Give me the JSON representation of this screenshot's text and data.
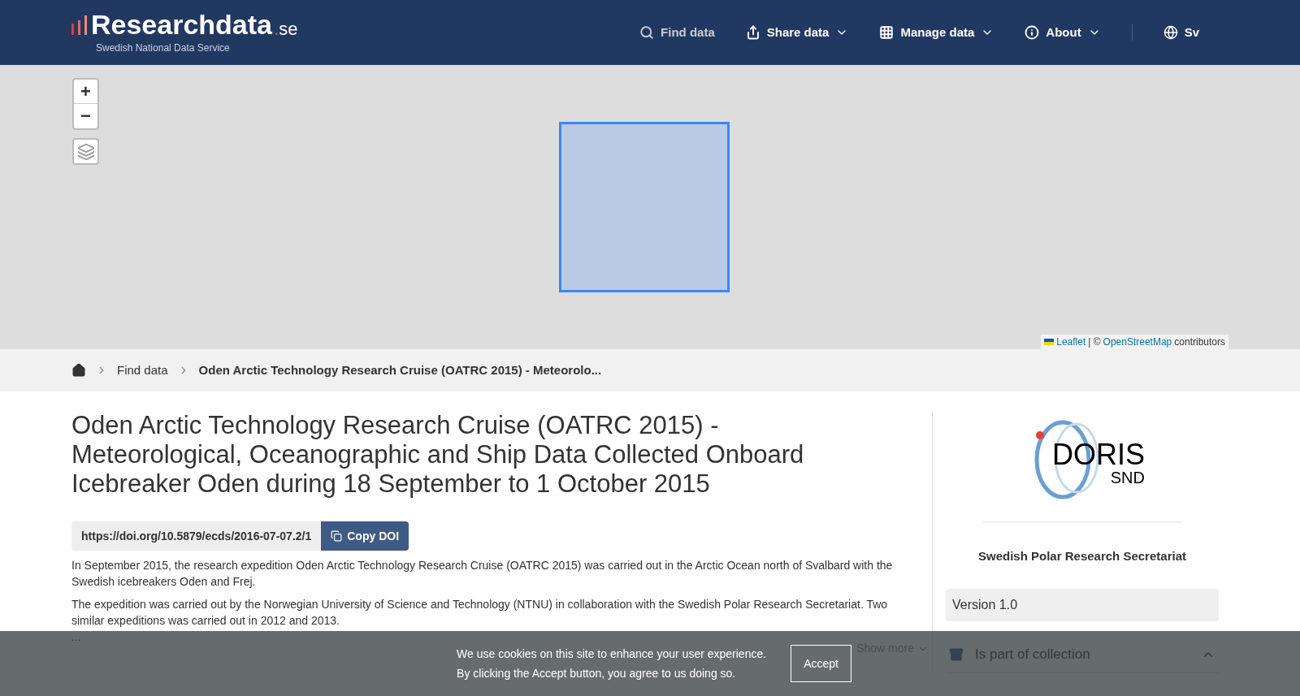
{
  "header": {
    "logo": {
      "name": "Researchdata",
      "suffix": ".se",
      "tagline": "Swedish National Data Service"
    },
    "nav": [
      {
        "kind": "search",
        "label": "Find data",
        "dropdown": false,
        "selected": true
      },
      {
        "kind": "share",
        "label": "Share data",
        "dropdown": true,
        "selected": false
      },
      {
        "kind": "grid",
        "label": "Manage data",
        "dropdown": true,
        "selected": false
      },
      {
        "kind": "info",
        "label": "About",
        "dropdown": true,
        "selected": false
      }
    ],
    "language": {
      "label": "Sv",
      "selected": false
    }
  },
  "map": {
    "zoom_in": "+",
    "zoom_out": "−",
    "attribution": {
      "leaflet": "Leaflet",
      "sep": "| ©",
      "osm": "OpenStreetMap",
      "rest": "contributors"
    }
  },
  "breadcrumb": [
    {
      "label": "Find data",
      "current": false
    },
    {
      "label": "Oden Arctic Technology Research Cruise (OATRC 2015) - Meteorolo...",
      "current": true
    }
  ],
  "title": "Oden Arctic Technology Research Cruise (OATRC 2015) - Meteorological, Oceanographic and Ship Data Collected Onboard Icebreaker Oden during 18 September to 1 October 2015",
  "doi": {
    "value": "https://doi.org/10.5879/ecds/2016-07-07.2/1",
    "button": "Copy DOI"
  },
  "description": [
    "In September 2015, the research expedition Oden Arctic Technology Research Cruise (OATRC 2015) was carried out in the Arctic Ocean north of Svalbard with the Swedish icebreakers Oden and Frej.",
    "The expedition was carried out by the Norwegian University of Science and Technology (NTNU) in collaboration with the Swedish Polar Research Secretariat. Two similar expeditions was carried out in 2012 and 2013.",
    "..."
  ],
  "show_more": "Show more",
  "sidebar": {
    "logo": {
      "title": "DORIS",
      "subtitle": "SND"
    },
    "organization": "Swedish Polar Research Secretariat",
    "version": "Version 1.0",
    "collection": {
      "label": "Is part of collection",
      "expanded": true
    }
  },
  "cookie_banner": {
    "lines": [
      "We use cookies on this site to enhance your user experience.",
      "By clicking the Accept button, you agree to us doing so."
    ],
    "button": "Accept"
  }
}
